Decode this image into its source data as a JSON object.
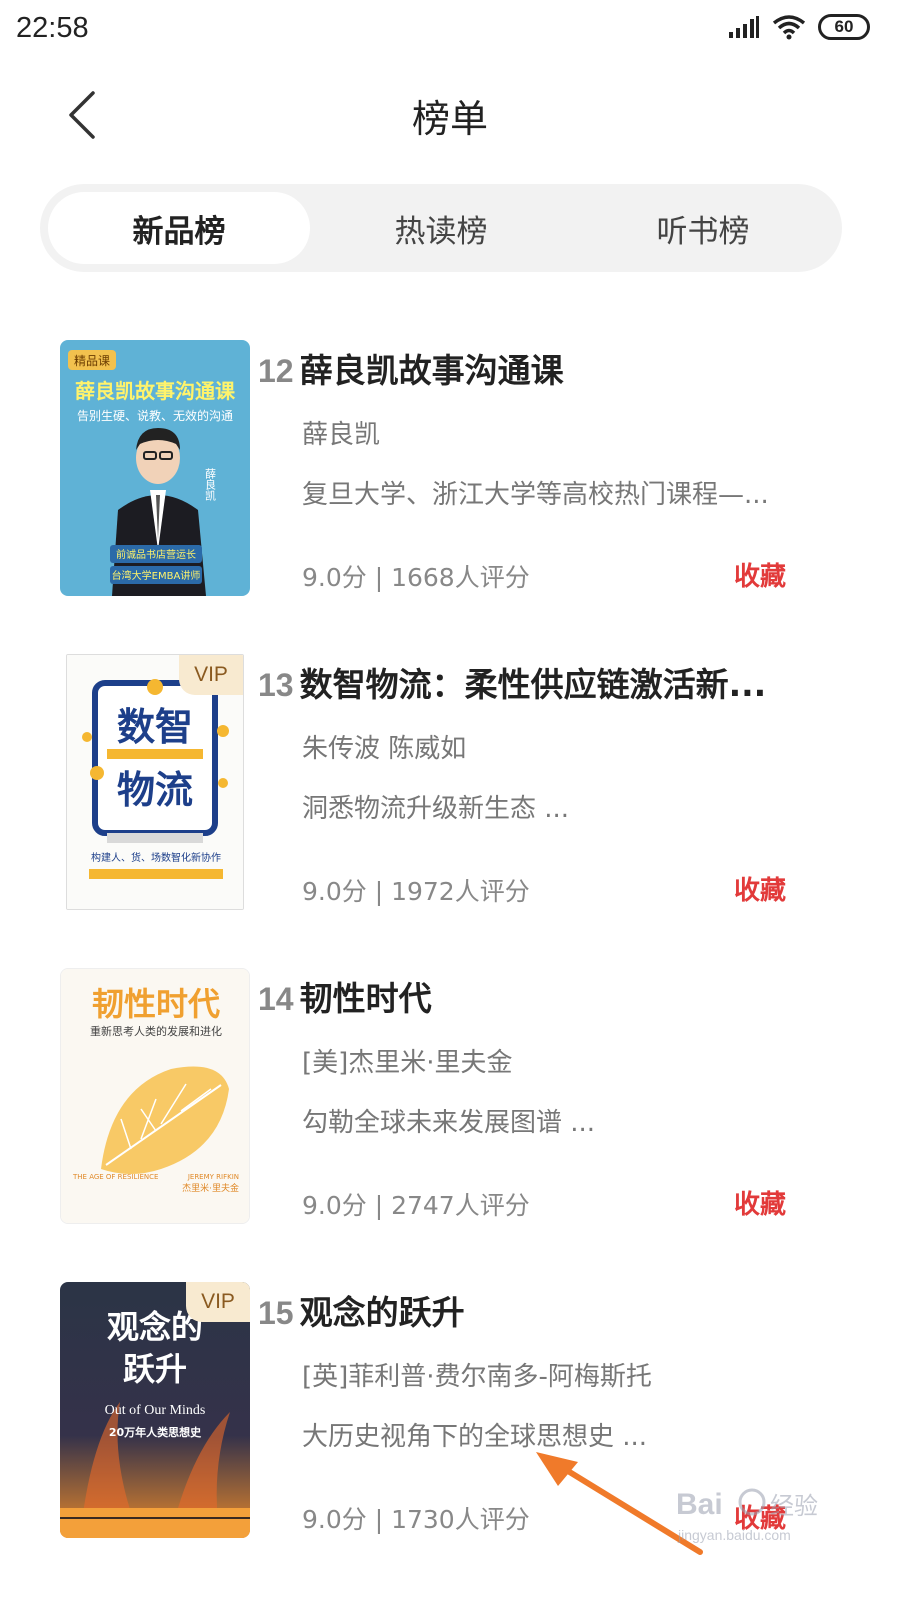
{
  "status_bar": {
    "time": "22:58",
    "battery": "60"
  },
  "header": {
    "title": "榜单"
  },
  "tabs": [
    {
      "label": "新品榜",
      "active": true
    },
    {
      "label": "热读榜",
      "active": false
    },
    {
      "label": "听书榜",
      "active": false
    }
  ],
  "books": [
    {
      "rank": "12",
      "title": "薛良凯故事沟通课",
      "author": "薛良凯",
      "description": "复旦大学、浙江大学等高校热门课程—...",
      "meta": "9.0分 | 1668人评分",
      "collect_label": "收藏",
      "vip": false,
      "cover": {
        "tag": "精品课",
        "title": "薛良凯故事沟通课",
        "subtitle": "告别生硬、说教、无效的沟通",
        "side_text": "薛良凯",
        "caption1": "前诚品书店营运长",
        "caption2": "台湾大学EMBA讲师"
      }
    },
    {
      "rank": "13",
      "title": "数智物流：柔性供应链激活新...",
      "author": "朱传波 陈威如",
      "description": "洞悉物流升级新生态 ...",
      "meta": "9.0分 | 1972人评分",
      "collect_label": "收藏",
      "vip": true,
      "vip_label": "VIP",
      "cover": {
        "title_line1": "数智",
        "title_line2": "物流",
        "subtitle": "构建人、货、场数智化新协作"
      }
    },
    {
      "rank": "14",
      "title": "韧性时代",
      "author": "[美]杰里米·里夫金",
      "description": "勾勒全球未来发展图谱 ...",
      "meta": "9.0分 | 2747人评分",
      "collect_label": "收藏",
      "vip": false,
      "cover": {
        "title": "韧性时代",
        "subtitle": "重新思考人类的发展和进化",
        "en_title": "THE AGE OF RESILIENCE",
        "en_author": "JEREMY RIFKIN",
        "cn_author": "杰里米·里夫金"
      }
    },
    {
      "rank": "15",
      "title": "观念的跃升",
      "author": "[英]菲利普·费尔南多-阿梅斯托",
      "description": "大历史视角下的全球思想史 ...",
      "meta": "9.0分 | 1730人评分",
      "collect_label": "收藏",
      "vip": true,
      "vip_label": "VIP",
      "cover": {
        "title_line1": "观念的",
        "title_line2": "跃升",
        "en_title": "Out of Our Minds",
        "subtitle": "20万年人类思想史"
      }
    }
  ],
  "watermark": {
    "brand": "Bai",
    "brand2": "经验",
    "url": "jingyan.baidu.com"
  },
  "colors": {
    "accent_red": "#e23a3a",
    "tab_bg": "#f2f2f2",
    "muted_text": "#777777"
  }
}
